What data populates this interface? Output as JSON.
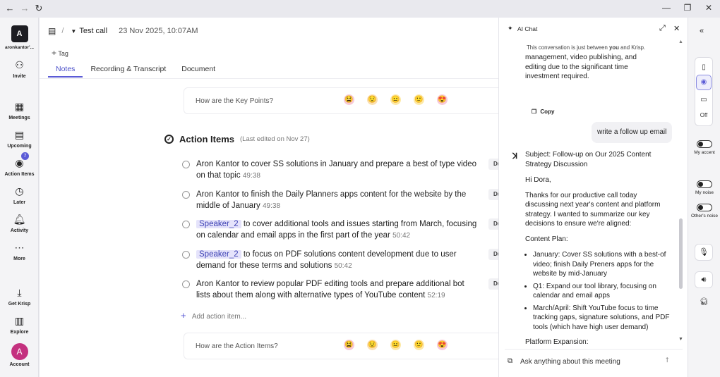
{
  "browser": {
    "back_icon": "arrow-left-icon",
    "forward_icon": "arrow-right-icon",
    "reload_icon": "reload-icon",
    "minimize_icon": "minimize-icon",
    "restore_icon": "restore-icon",
    "close_icon": "close-icon"
  },
  "sidebar": {
    "account_initial": "A",
    "account_name": "aronkantor'...",
    "items": [
      {
        "label": "Invite",
        "icon": "invite-user-icon"
      },
      {
        "label": "Meetings",
        "icon": "calendar-icon"
      },
      {
        "label": "Upcoming",
        "icon": "upcoming-calendar-icon"
      },
      {
        "label": "Action Items",
        "icon": "check-circle-icon",
        "badge": "7"
      },
      {
        "label": "Later",
        "icon": "clock-icon"
      },
      {
        "label": "Activity",
        "icon": "bell-icon"
      },
      {
        "label": "More",
        "icon": "more-dots-icon"
      },
      {
        "label": "Get Krisp",
        "icon": "download-icon"
      },
      {
        "label": "Explore",
        "icon": "book-icon"
      }
    ],
    "bottom_account_initial": "A",
    "bottom_account_label": "Account"
  },
  "main": {
    "meeting_title": "Test call",
    "meeting_date": "23 Nov 2025, 10:07AM",
    "tag_label": "Tag",
    "tabs": [
      {
        "label": "Notes",
        "active": true
      },
      {
        "label": "Recording & Transcript",
        "active": false
      },
      {
        "label": "Document",
        "active": false
      }
    ],
    "key_points_question": "How are the Key Points?",
    "action_items_title": "Action Items",
    "action_items_edited": "(Last edited on Nov 27)",
    "due_label": "Du",
    "action_items": [
      {
        "speaker": "",
        "text": "Aron Kantor to cover SS solutions in January and prepare a best of type video on that topic",
        "time": "49:38"
      },
      {
        "speaker": "",
        "text": "Aron Kantor to finish the Daily Planners apps content for the website by the middle of January",
        "time": "49:38"
      },
      {
        "speaker": "Speaker_2",
        "text": "to cover additional tools and issues starting from March, focusing on calendar and email apps in the first part of the year",
        "time": "50:42"
      },
      {
        "speaker": "Speaker_2",
        "text": "to focus on PDF solutions content development due to user demand for these terms and solutions",
        "time": "50:42"
      },
      {
        "speaker": "",
        "text": "Aron Kantor to review popular PDF editing tools and prepare additional bot lists about them along with alternative types of YouTube content",
        "time": "52:19"
      }
    ],
    "add_action_placeholder": "Add action item...",
    "action_items_question": "How are the Action Items?",
    "emojis": [
      "😫",
      "😟",
      "😐",
      "🙂",
      "😍"
    ]
  },
  "chat": {
    "title": "AI Chat",
    "privacy_prefix": "This conversation is just between ",
    "privacy_you": "you",
    "privacy_suffix": " and Krisp.",
    "previous_message_tail": "management, video publishing, and editing due to the significant time investment required.",
    "copy_label": "Copy",
    "user_message": "write a follow up email",
    "reply": {
      "subject": "Subject: Follow-up on Our 2025 Content Strategy Discussion",
      "greeting": "Hi Dora,",
      "body": "Thanks for our productive call today discussing next year's content and platform strategy. I wanted to summarize our key decisions to ensure we're aligned:",
      "plan_heading": "Content Plan:",
      "plan_items": [
        "January: Cover SS solutions with a best-of video; finish Daily Preners apps for the website by mid-January",
        "Q1: Expand our tool library, focusing on calendar and email apps",
        "March/April: Shift YouTube focus to time tracking gaps, signature solutions, and PDF tools (which have high user demand)"
      ],
      "expansion_heading": "Platform Expansion:"
    },
    "input_placeholder": "Ask anything about this meeting"
  },
  "rail": {
    "off_label": "Off",
    "my_accent_label": "My accent",
    "my_noise_label": "My noise",
    "others_noise_label": "Other's noise"
  },
  "colors": {
    "accent": "#5b5bd6",
    "speaker_bg": "#e5e3fb",
    "account_avatar": "#c4317f"
  }
}
